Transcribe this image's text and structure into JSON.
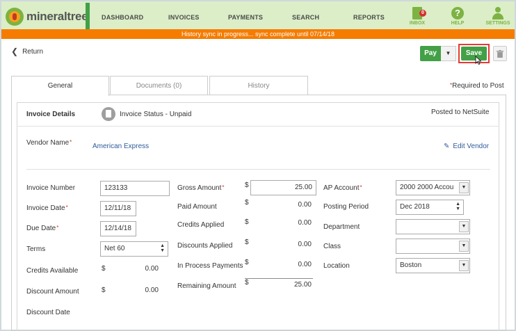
{
  "app": {
    "logo_text": "mineraltree",
    "nav": {
      "dashboard": "DASHBOARD",
      "invoices": "INVOICES",
      "payments": "PAYMENTS",
      "search": "SEARCH",
      "reports": "REPORTS"
    },
    "icons": {
      "inbox": "INBOX",
      "inbox_badge": "0",
      "help": "HELP",
      "help_glyph": "?",
      "settings": "SETTINGS"
    },
    "accent_color": "#43a047",
    "banner_color": "#f57c00"
  },
  "banner": "History sync in progress... sync complete until 07/14/18",
  "actions": {
    "return": "Return",
    "pay": "Pay",
    "save": "Save"
  },
  "tabs": [
    {
      "label": "General"
    },
    {
      "label": "Documents (0)"
    },
    {
      "label": "History"
    }
  ],
  "required_note": "Required to Post",
  "details": {
    "heading": "Invoice Details",
    "status": "Invoice Status - Unpaid",
    "posted_to": "Posted to NetSuite",
    "vendor_label": "Vendor Name",
    "vendor_value": "American Express",
    "edit_vendor": "Edit Vendor"
  },
  "left_col": {
    "invoice_number_label": "Invoice Number",
    "invoice_number": "123133",
    "invoice_date_label": "Invoice Date",
    "invoice_date": "12/11/18",
    "due_date_label": "Due Date",
    "due_date": "12/14/18",
    "terms_label": "Terms",
    "terms": "Net 60",
    "credits_available_label": "Credits Available",
    "credits_available": "0.00",
    "discount_amount_label": "Discount Amount",
    "discount_amount": "0.00",
    "discount_date_label": "Discount Date"
  },
  "mid_col": {
    "currency": "$",
    "gross_amount_label": "Gross Amount",
    "gross_amount": "25.00",
    "paid_amount_label": "Paid Amount",
    "paid_amount": "0.00",
    "credits_applied_label": "Credits Applied",
    "credits_applied": "0.00",
    "discounts_applied_label": "Discounts Applied",
    "discounts_applied": "0.00",
    "in_process_label": "In Process Payments",
    "in_process": "0.00",
    "remaining_label": "Remaining Amount",
    "remaining": "25.00"
  },
  "right_col": {
    "ap_account_label": "AP Account",
    "ap_account": "2000 2000 Accou",
    "posting_period_label": "Posting Period",
    "posting_period": "Dec 2018",
    "department_label": "Department",
    "department": "",
    "class_label": "Class",
    "class": "",
    "location_label": "Location",
    "location": "Boston"
  }
}
